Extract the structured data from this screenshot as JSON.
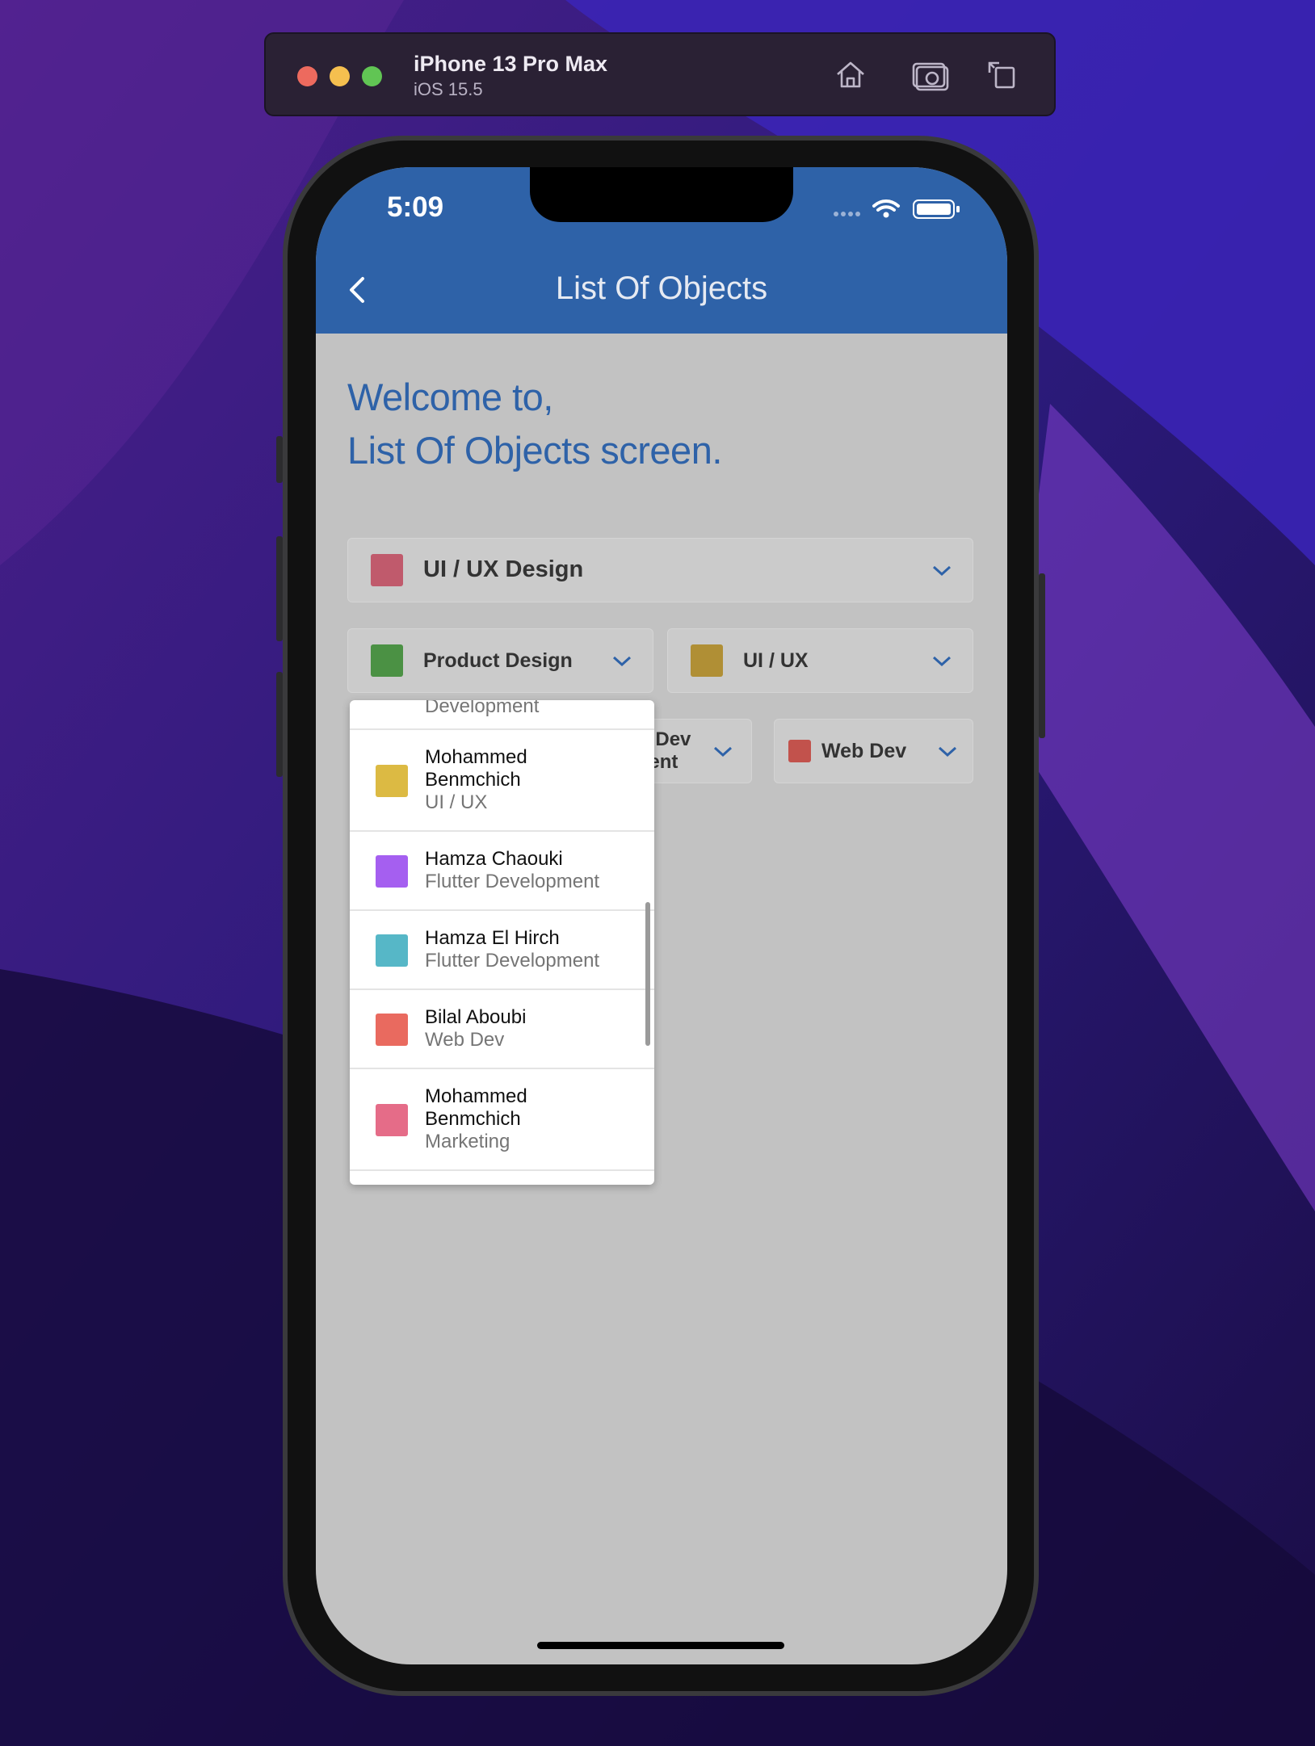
{
  "simulator": {
    "device_name": "iPhone 13 Pro Max",
    "os_version": "iOS 15.5",
    "icons": [
      "home-icon",
      "screenshot-icon",
      "rotate-icon"
    ]
  },
  "status_bar": {
    "time": "5:09"
  },
  "app_bar": {
    "title": "List Of Objects"
  },
  "welcome": {
    "line1": "Welcome to,",
    "line2": "List Of Objects screen."
  },
  "dropdowns": {
    "full": {
      "label": "UI / UX Design",
      "color": "#c05a6c"
    },
    "left": {
      "label": "Product Design",
      "color": "#4b9144"
    },
    "right": {
      "label": "UI / UX",
      "color": "#b08f35"
    },
    "partial_line1": "er Dev",
    "partial_line2": "ment",
    "web": {
      "label": "Web Dev",
      "color": "#c2524c"
    }
  },
  "popup": {
    "cut_top_text": "Development",
    "items": [
      {
        "name_line1": "Mohammed",
        "name_line2": "Benmchich",
        "role": "UI / UX",
        "color": "#dcba43"
      },
      {
        "name": "Hamza Chaouki",
        "role": "Flutter Development",
        "color": "#a55ff0"
      },
      {
        "name": "Hamza El Hirch",
        "role": "Flutter Development",
        "color": "#56b7c7"
      },
      {
        "name": "Bilal Aboubi",
        "role": "Web Dev",
        "color": "#e96a5f"
      },
      {
        "name_line1": "Mohammed",
        "name_line2": "Benmchich",
        "role": "Marketing",
        "color": "#e56c88"
      }
    ]
  },
  "colors": {
    "accent": "#2e62a8",
    "background": "#c2c2c2"
  }
}
